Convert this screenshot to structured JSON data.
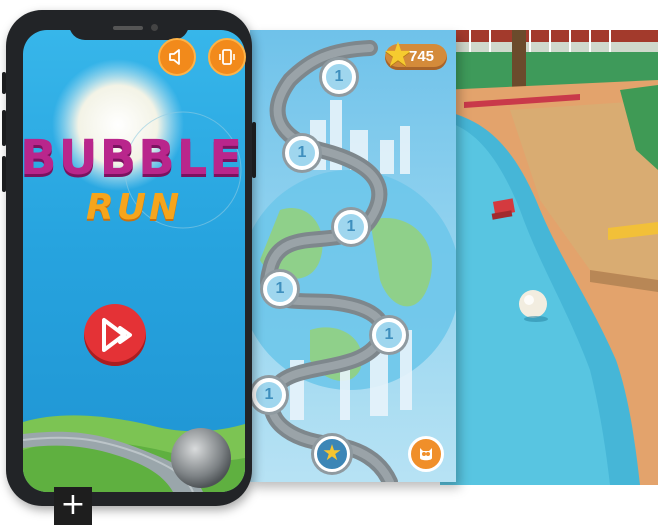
{
  "menu_screen": {
    "title_line1": "BUBBLE",
    "title_line2": "RUN",
    "sound_icon": "speaker-icon",
    "vibrate_icon": "vibrate-icon",
    "play_icon": "play-icon"
  },
  "level_map": {
    "coins": "745",
    "levels": [
      "1",
      "1",
      "1",
      "1",
      "1",
      "1"
    ],
    "bottom_left_icon": "star-icon",
    "bottom_right_icon": "owl-icon"
  },
  "decor": {
    "plus_glyph": "+"
  },
  "colors": {
    "title_magenta": "#b9268c",
    "title_orange": "#f6a51c",
    "button_orange": "#f28a1b",
    "play_red": "#e43236",
    "sky_blue": "#27a4df"
  }
}
